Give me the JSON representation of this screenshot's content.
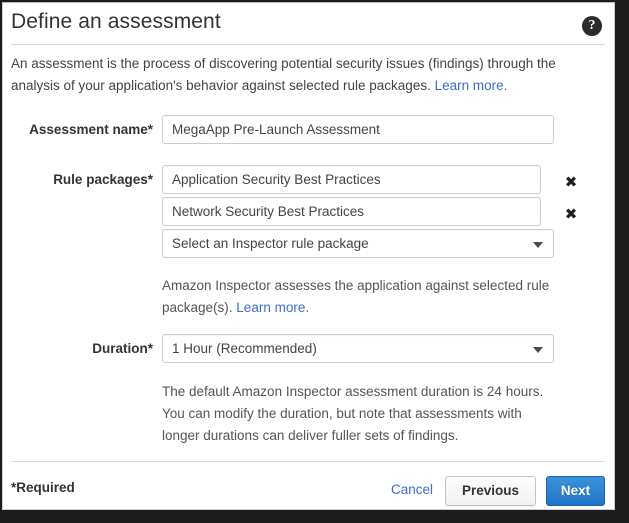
{
  "dialog": {
    "title": "Define an assessment",
    "help_icon": "help-circle-icon",
    "intro_text": "An assessment is the process of discovering potential security issues (findings) through the analysis of your application's behavior against selected rule packages. ",
    "intro_link": "Learn more."
  },
  "form": {
    "assessment_name": {
      "label": "Assessment name",
      "required_mark": "*",
      "value": "MegaApp Pre-Launch Assessment",
      "placeholder": "Assessment name"
    },
    "rule_packages": {
      "label": "Rule packages",
      "required_mark": "*",
      "selected": [
        {
          "value": "Application Security Best Practices",
          "remove_icon": "✖"
        },
        {
          "value": "Network Security Best Practices",
          "remove_icon": "✖"
        }
      ],
      "select_placeholder": "Select an Inspector rule package",
      "caret_icon": "chevron-down-icon",
      "helper_text": "Amazon Inspector assesses the application against selected rule package(s). ",
      "helper_link": "Learn more."
    },
    "duration": {
      "label": "Duration",
      "required_mark": "*",
      "selected": "1 Hour (Recommended)",
      "caret_icon": "chevron-down-icon",
      "helper_text": "The default Amazon Inspector assessment duration is 24 hours. You can modify the duration, but note that assessments with longer durations can deliver fuller sets of findings."
    }
  },
  "footer": {
    "required_note": "*Required",
    "cancel_label": "Cancel",
    "previous_label": "Previous",
    "next_label": "Next"
  },
  "colors": {
    "link": "#3b6ecc",
    "primary_button": "#1f76c6",
    "text": "#333333",
    "border": "#cccccc"
  }
}
